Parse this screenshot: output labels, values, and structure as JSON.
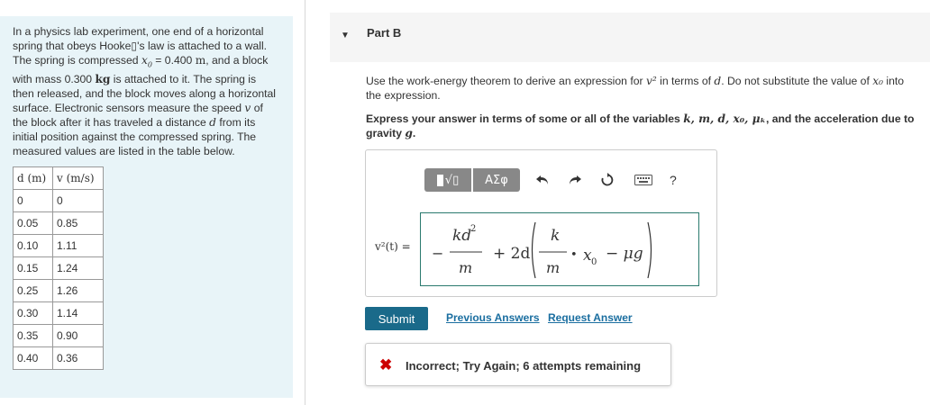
{
  "problem": {
    "text_1": "In a physics lab experiment, one end of a horizontal spring that obeys Hooke▯'s law is attached to a wall. The spring is compressed ",
    "x0_sym": "x",
    "x0_sub": "0",
    "text_2": " = 0.400 ",
    "unit_m": "m",
    "text_3": ", and a block with mass 0.300 ",
    "unit_kg": "kg",
    "text_4": " is attached to it. The spring is then released, and the block moves along a horizontal surface. Electronic sensors measure the speed ",
    "v_sym": "v",
    "text_5": " of the block after it has traveled a distance ",
    "d_sym": "d",
    "text_6": " from its initial position against the compressed spring. The measured values are listed in the table below."
  },
  "table": {
    "headers": [
      "d (m)",
      "v (m/s)"
    ],
    "rows": [
      [
        "0",
        "0"
      ],
      [
        "0.05",
        "0.85"
      ],
      [
        "0.10",
        "1.11"
      ],
      [
        "0.15",
        "1.24"
      ],
      [
        "0.25",
        "1.26"
      ],
      [
        "0.30",
        "1.14"
      ],
      [
        "0.35",
        "0.90"
      ],
      [
        "0.40",
        "0.36"
      ]
    ]
  },
  "part": {
    "title": "Part B",
    "arrow_icon": "triangle-down-icon"
  },
  "instructions": {
    "line1_a": "Use the work-energy theorem to derive an expression for ",
    "line1_v2": "v²",
    "line1_b": " in terms of ",
    "line1_d": "d",
    "line1_c": ". Do not substitute the value of ",
    "line1_x0": "x₀",
    "line1_d2": " into the expression.",
    "line2_a": "Express your answer in terms of some or all of the variables ",
    "line2_vars": "k, m, d, x₀, μₖ",
    "line2_b": ", and the acceleration due to gravity ",
    "line2_g": "g",
    "line2_c": "."
  },
  "toolbar": {
    "templates_label": "√▯",
    "greek_label": "ΑΣφ",
    "help_label": "?",
    "icons": [
      "undo-icon",
      "redo-icon",
      "reset-icon",
      "keyboard-icon"
    ]
  },
  "answer": {
    "lhs": "v²(t) =",
    "expr": {
      "minus": "−",
      "num1": "kd",
      "num1_exp": "2",
      "den1": "m",
      "plus": "+ 2d",
      "num2": "k",
      "den2": "m",
      "bullet": "•",
      "x": "x",
      "x_sub": "0",
      "tail": "− μg"
    }
  },
  "actions": {
    "submit": "Submit",
    "previous_answers": "Previous Answers",
    "request_answer": "Request Answer"
  },
  "feedback": {
    "icon": "x-icon",
    "text": "Incorrect; Try Again; 6 attempts remaining",
    "color": "#cc0000"
  },
  "colors": {
    "panel_bg": "#e8f4f8",
    "submit_bg": "#1a6a8a",
    "link": "#1a6ea0",
    "answer_border": "#2a7a6e"
  }
}
